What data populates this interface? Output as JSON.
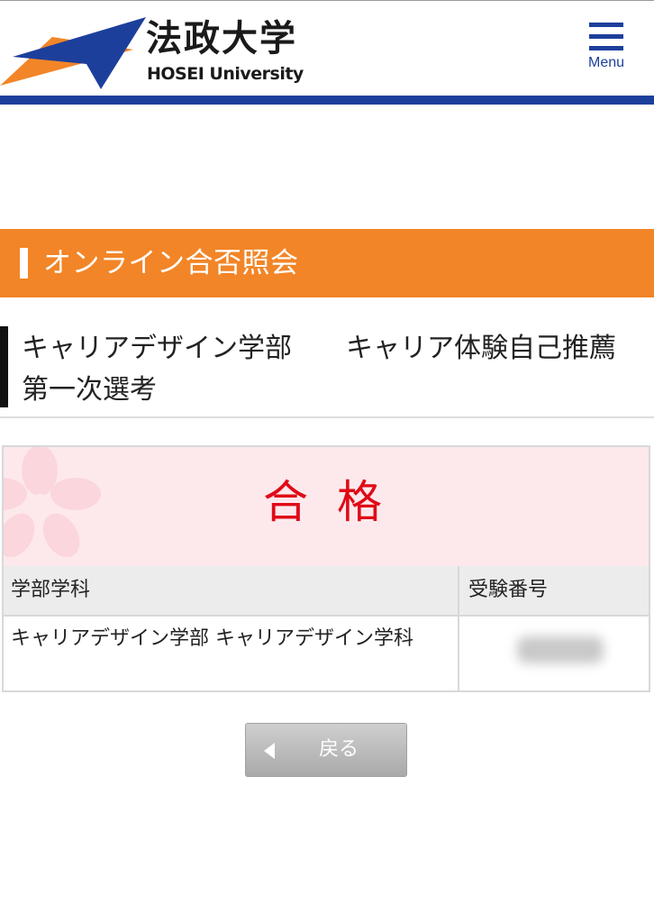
{
  "header": {
    "logo_jp": "法政大学",
    "logo_en": "HOSEI University",
    "menu_label": "Menu",
    "menu_icon": "hamburger-icon",
    "brand_blue": "#1d3f9c",
    "brand_orange": "#f28527"
  },
  "section": {
    "title": "オンライン合否照会"
  },
  "exam": {
    "title": "キャリアデザイン学部　　キャリア体験自己推薦　第一次選考"
  },
  "result": {
    "status": "合 格",
    "status_color": "#e00a17",
    "decoration_icon": "sakura-icon",
    "table": {
      "headers": [
        "学部学科",
        "受験番号"
      ],
      "department": "キャリアデザイン学部 キャリアデザイン学科"
    }
  },
  "back_button": {
    "label": "戻る",
    "icon": "triangle-left-icon"
  }
}
